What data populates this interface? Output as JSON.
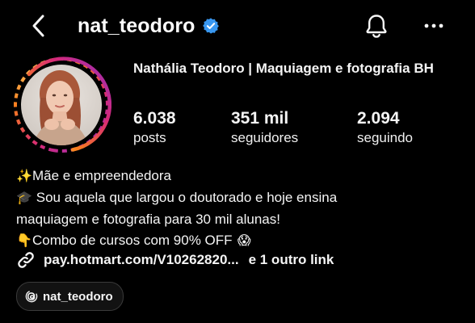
{
  "header": {
    "username": "nat_teodoro",
    "verified": true,
    "icons": {
      "back": "chevron-left-icon",
      "verified": "verified-badge-icon",
      "notifications": "bell-icon",
      "more": "more-horizontal-icon"
    },
    "colors": {
      "verified": "#3897F0"
    }
  },
  "profile": {
    "display_name": "Nathália Teodoro | Maquiagem e fotografia BH",
    "story_ring_colors": [
      "#feda75",
      "#fa7e1e",
      "#d62976",
      "#962fbf"
    ],
    "stats": {
      "posts": {
        "value": "6.038",
        "label": "posts"
      },
      "followers": {
        "value": "351 mil",
        "label": "seguidores"
      },
      "following": {
        "value": "2.094",
        "label": "seguindo"
      }
    }
  },
  "bio": {
    "lines": [
      {
        "emoji": "✨",
        "text": "Mãe e empreendedora"
      },
      {
        "emoji": "🎓",
        "text": "Sou aquela que largou o doutorado e hoje ensina"
      },
      {
        "emoji": "",
        "text": "maquiagem e fotografia para 30 mil alunas!"
      },
      {
        "emoji": "👇",
        "text": "Combo de cursos com 90% OFF",
        "trailing_emoji": "😱"
      }
    ]
  },
  "link": {
    "icon": "link-icon",
    "url": "pay.hotmart.com/V10262820...",
    "more": "e 1 outro link"
  },
  "threads": {
    "icon": "threads-icon",
    "label": "nat_teodoro"
  }
}
